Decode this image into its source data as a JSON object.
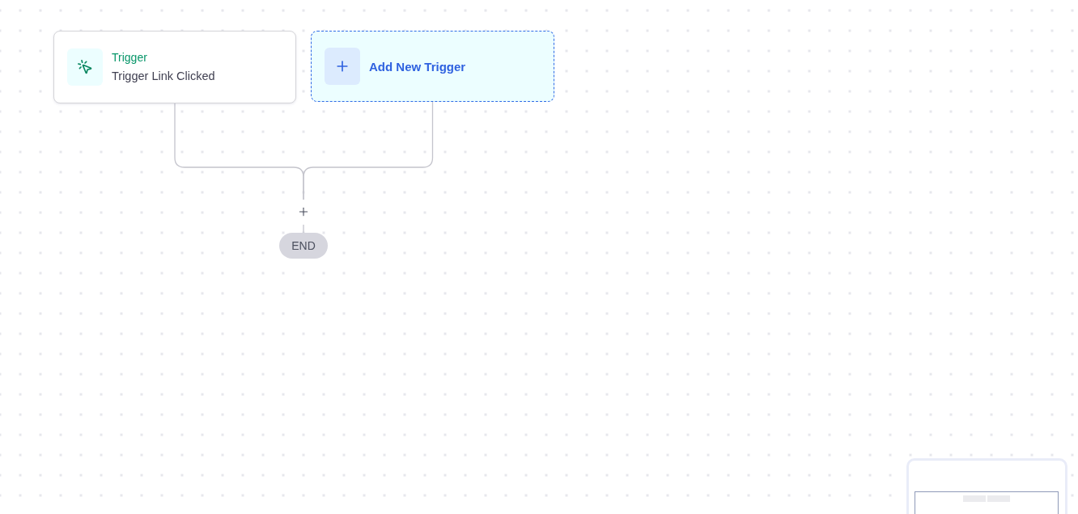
{
  "canvas": {
    "nodes": [
      {
        "kind": "trigger",
        "title": "Trigger",
        "subtitle": "Trigger Link Clicked"
      },
      {
        "kind": "add",
        "label": "Add New Trigger"
      }
    ],
    "end": {
      "label": "END"
    }
  }
}
